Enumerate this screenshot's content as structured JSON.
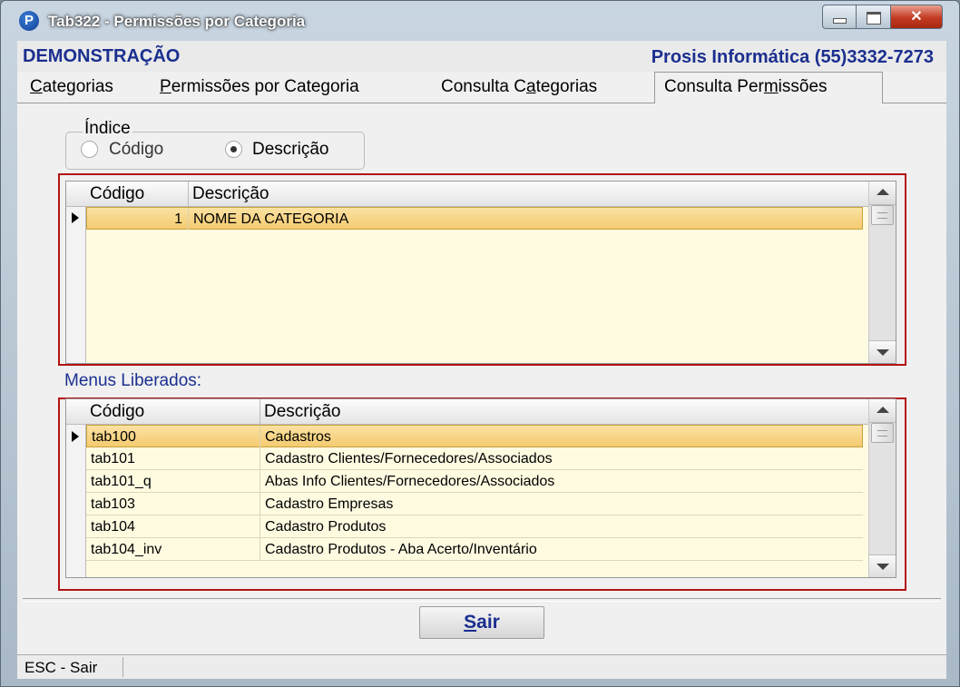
{
  "window": {
    "title": "Tab322 - Permissões por Categoria",
    "app_icon_letter": "P",
    "close_glyph": "✕"
  },
  "header": {
    "left_text": "DEMONSTRAÇÃO",
    "right_text": "Prosis Informática (55)3332-7273"
  },
  "tabs": [
    {
      "pre": "",
      "mnemonic": "C",
      "post": "ategorias"
    },
    {
      "pre": "",
      "mnemonic": "P",
      "post": "ermissões por Categoria"
    },
    {
      "pre": "Consulta C",
      "mnemonic": "a",
      "post": "tegorias"
    },
    {
      "pre": "Consulta Per",
      "mnemonic": "m",
      "post": "issões",
      "active": true
    }
  ],
  "index_group": {
    "label": "Índice",
    "options": [
      "Código",
      "Descrição"
    ],
    "selected": "Descrição"
  },
  "categories_grid": {
    "columns": [
      "Código",
      "Descrição"
    ],
    "rows": [
      {
        "codigo": "1",
        "descricao": "NOME DA CATEGORIA"
      }
    ]
  },
  "menus_label": "Menus Liberados:",
  "menus_grid": {
    "columns": [
      "Código",
      "Descrição"
    ],
    "rows": [
      {
        "codigo": "tab100",
        "descricao": "Cadastros"
      },
      {
        "codigo": "tab101",
        "descricao": "Cadastro Clientes/Fornecedores/Associados"
      },
      {
        "codigo": "tab101_q",
        "descricao": "Abas Info Clientes/Fornecedores/Associados"
      },
      {
        "codigo": "tab103",
        "descricao": "Cadastro Empresas"
      },
      {
        "codigo": "tab104",
        "descricao": "Cadastro Produtos"
      },
      {
        "codigo": "tab104_inv",
        "descricao": "Cadastro Produtos - Aba Acerto/Inventário"
      }
    ]
  },
  "buttons": {
    "sair_mnemonic": "S",
    "sair_rest": "air"
  },
  "status": {
    "text": "ESC - Sair"
  },
  "colors": {
    "highlight": "#b31212",
    "grid_bg": "#fffbe1",
    "selected_row": "#f4cb70",
    "label_blue": "#1b2f8f"
  }
}
